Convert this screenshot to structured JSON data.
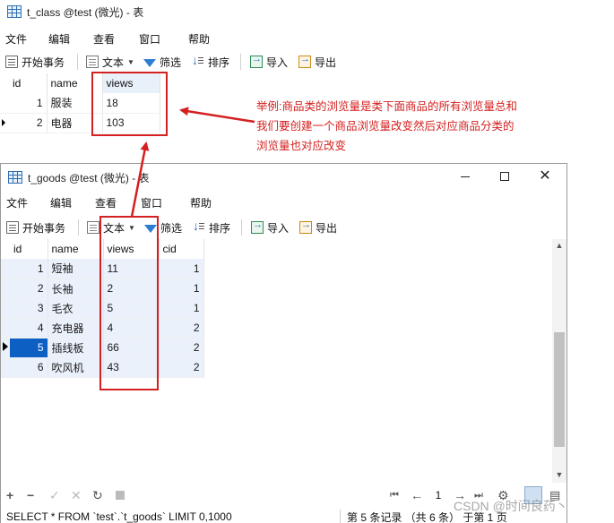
{
  "window1": {
    "title": "t_class @test (微光) - 表",
    "menu": [
      "文件",
      "编辑",
      "查看",
      "窗口",
      "帮助"
    ],
    "toolbar": {
      "begin_tx": "开始事务",
      "text": "文本",
      "filter": "筛选",
      "sort": "排序",
      "import": "导入",
      "export": "导出"
    },
    "columns": [
      "id",
      "name",
      "views"
    ],
    "rows": [
      {
        "id": "1",
        "name": "服装",
        "views": "18"
      },
      {
        "id": "2",
        "name": "电器",
        "views": "103"
      }
    ]
  },
  "window2": {
    "title": "t_goods @test (微光) - 表",
    "menu": [
      "文件",
      "编辑",
      "查看",
      "窗口",
      "帮助"
    ],
    "toolbar": {
      "begin_tx": "开始事务",
      "text": "文本",
      "filter": "筛选",
      "sort": "排序",
      "import": "导入",
      "export": "导出"
    },
    "columns": [
      "id",
      "name",
      "views",
      "cid"
    ],
    "rows": [
      {
        "id": "1",
        "name": "短袖",
        "views": "11",
        "cid": "1"
      },
      {
        "id": "2",
        "name": "长袖",
        "views": "2",
        "cid": "1"
      },
      {
        "id": "3",
        "name": "毛衣",
        "views": "5",
        "cid": "1"
      },
      {
        "id": "4",
        "name": "充电器",
        "views": "4",
        "cid": "2"
      },
      {
        "id": "5",
        "name": "插线板",
        "views": "66",
        "cid": "2"
      },
      {
        "id": "6",
        "name": "吹风机",
        "views": "43",
        "cid": "2"
      }
    ],
    "page_number": "1",
    "status_sql": "SELECT * FROM `test`.`t_goods` LIMIT 0,1000",
    "status_record": "第 5 条记录 （共 6 条） 于第 1 页",
    "watermark": "CSDN @时间良药丶"
  },
  "annotation": {
    "lines": [
      "举例:商品类的浏览量是类下面商品的所有浏览量总和",
      "我们要创建一个商品浏览量改变然后对应商品分类的",
      "浏览量也对应改变"
    ],
    "color": "#d42020"
  }
}
